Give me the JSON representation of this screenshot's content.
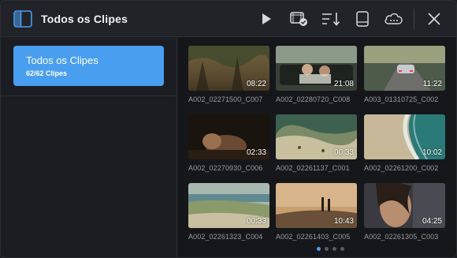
{
  "header": {
    "title": "Todos os Clipes",
    "icons": [
      "sidebar-toggle-icon",
      "play-icon",
      "clip-check-icon",
      "sort-icon",
      "storage-icon",
      "cloud-icon",
      "close-icon"
    ]
  },
  "sidebar": {
    "collection": {
      "name": "Todos os Clipes",
      "count": "62/62 Clipes"
    }
  },
  "clips": [
    {
      "name": "A002_02271500_C007",
      "duration": "08:22",
      "scene": "forest"
    },
    {
      "name": "A002_02280720_C008",
      "duration": "21:08",
      "scene": "car-interior"
    },
    {
      "name": "A003_01310725_C002",
      "duration": "11:22",
      "scene": "road-car"
    },
    {
      "name": "A002_02270930_C006",
      "duration": "02:33",
      "scene": "portrait-dark"
    },
    {
      "name": "A002_02261137_C001",
      "duration": "00:33",
      "scene": "aerial-beach"
    },
    {
      "name": "A002_02261200_C002",
      "duration": "10:02",
      "scene": "aerial-waves"
    },
    {
      "name": "A002_02261323_C004",
      "duration": "00:33",
      "scene": "coast"
    },
    {
      "name": "A002_02261403_C005",
      "duration": "10:43",
      "scene": "sunset-couple"
    },
    {
      "name": "A002_02261305_C003",
      "duration": "04:25",
      "scene": "portrait-woman"
    }
  ],
  "pagination": {
    "pages": 4,
    "current": 1
  },
  "colors": {
    "accent": "#4a9ef0",
    "background": "#1a1b20"
  }
}
